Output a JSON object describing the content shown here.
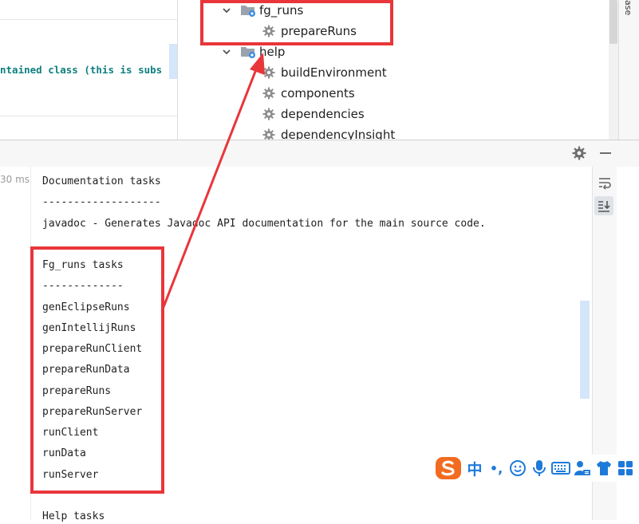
{
  "editor": {
    "code_fragment": "ntained class (this is subs"
  },
  "tree": {
    "items": [
      {
        "label": "fg_runs",
        "type": "group",
        "expanded": true
      },
      {
        "label": "prepareRuns",
        "type": "task"
      },
      {
        "label": "help",
        "type": "group",
        "expanded": true
      },
      {
        "label": "buildEnvironment",
        "type": "task"
      },
      {
        "label": "components",
        "type": "task"
      },
      {
        "label": "dependencies",
        "type": "task"
      },
      {
        "label": "dependencyInsight",
        "type": "task"
      }
    ]
  },
  "right_strip": {
    "label": "ase"
  },
  "run": {
    "elapsed": "30 ms"
  },
  "console": {
    "lines": [
      "Documentation tasks",
      "-------------------",
      "javadoc - Generates Javadoc API documentation for the main source code.",
      "",
      "Fg_runs tasks",
      "-------------",
      "genEclipseRuns",
      "genIntellijRuns",
      "prepareRunClient",
      "prepareRunData",
      "prepareRuns",
      "prepareRunServer",
      "runClient",
      "runData",
      "runServer",
      "",
      "Help tasks"
    ]
  },
  "ime": {
    "items": [
      "sogou-logo",
      "中",
      "•,",
      "emoji-icon",
      "microphone-icon",
      "keyboard-icon",
      "user-icon",
      "shirt-icon",
      "grid-icon"
    ],
    "chinese_label": "中",
    "punct_label": "•,"
  },
  "colors": {
    "highlight_red": "#e8363a",
    "code_teal": "#0f7f7f",
    "marker_blue": "#d4e6fa",
    "sogou_orange": "#f26b21",
    "ime_blue": "#1e7ad9"
  }
}
